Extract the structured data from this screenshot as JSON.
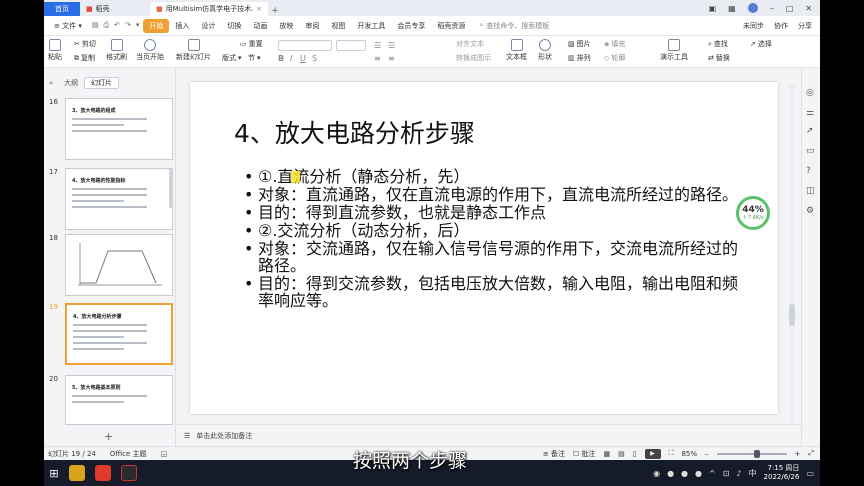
{
  "titlebar": {
    "home_tab": "首页",
    "shell_tab": "稻壳",
    "doc_tab": "用Multisim仿真学电子技术.pptx",
    "plus": "+"
  },
  "menubar": {
    "file": "文件",
    "items": [
      "开始",
      "插入",
      "设计",
      "切换",
      "动画",
      "放映",
      "审阅",
      "视图",
      "开发工具",
      "会员专享",
      "稻壳资源"
    ],
    "search": "查找命令、搜索模板",
    "right": [
      "未同步",
      "协作",
      "分享"
    ]
  },
  "ribbon": {
    "paste": "粘贴",
    "cut": "剪切",
    "copy": "复制",
    "format_painter": "格式刷",
    "from_current": "当页开始",
    "new_slide": "新建幻灯片",
    "layout": "版式",
    "section": "节",
    "reset": "重置",
    "text_box": "文本框",
    "shape": "形状",
    "arrange": "排列",
    "picture": "图片",
    "fill": "填充",
    "outline": "轮廓",
    "find": "查找",
    "replace": "替换",
    "select": "选择",
    "presentation_tools": "演示工具",
    "align_text": "对齐文本",
    "convert_smartart": "转换成图示"
  },
  "leftpanel": {
    "tab_outline": "大纲",
    "tab_slides": "幻灯片",
    "slides": [
      {
        "num": "16",
        "title": "3、放大电路的组成",
        "selected": false
      },
      {
        "num": "17",
        "title": "4、放大电路的性能指标",
        "selected": false
      },
      {
        "num": "18",
        "title": "",
        "selected": false
      },
      {
        "num": "19",
        "title": "4、放大电路分析步骤",
        "selected": true
      },
      {
        "num": "20",
        "title": "5、放大电路基本原则",
        "selected": false
      }
    ]
  },
  "slide": {
    "title": "4、放大电路分析步骤",
    "bullets": [
      "①.直流分析（静态分析，先）",
      "对象：直流通路，仅在直流电源的作用下，直流电流所经过的路径。",
      "目的：得到直流参数，也就是静态工作点",
      "②.交流分析（动态分析，后）",
      "对象：交流通路，仅在输入信号信号源的作用下，交流电流所经过的路径。",
      "目的：得到交流参数，包括电压放大倍数，输入电阻，输出电阻和频率响应等。"
    ]
  },
  "perf_widget": {
    "percent": "44%",
    "speed": "↑ 7.6K/s"
  },
  "notes": {
    "placeholder": "单击此处添加备注"
  },
  "statusbar": {
    "slide_count": "幻灯片 19 / 24",
    "theme": "Office 主题",
    "notes": "备注",
    "comments": "批注",
    "zoom": "85%",
    "zoom_level": 0.58
  },
  "subtitle": "按照两个步骤",
  "taskbar": {
    "time": "7:15 周日",
    "date": "2022/6/26",
    "ime": "中"
  },
  "colors": {
    "accent": "#f0a030",
    "taskbar": "#151b29",
    "home_tab": "#2a6ee6"
  }
}
